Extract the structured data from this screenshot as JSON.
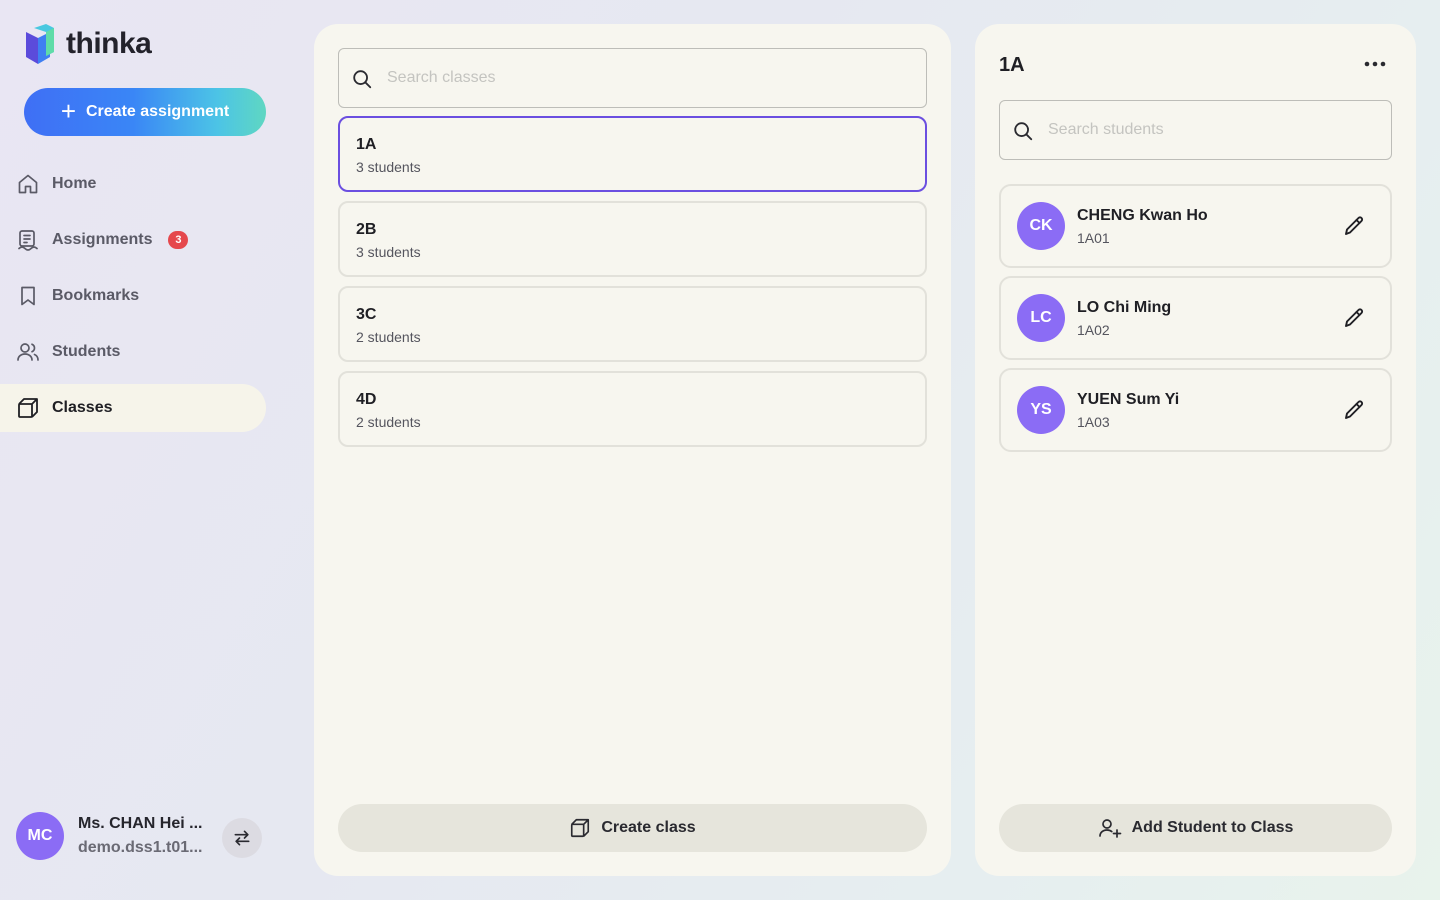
{
  "brand": {
    "name": "thinka"
  },
  "sidebar": {
    "create_label": "Create assignment",
    "items": [
      {
        "label": "Home",
        "icon": "home-icon"
      },
      {
        "label": "Assignments",
        "icon": "assignments-icon",
        "badge": "3"
      },
      {
        "label": "Bookmarks",
        "icon": "bookmark-icon"
      },
      {
        "label": "Students",
        "icon": "users-icon"
      },
      {
        "label": "Classes",
        "icon": "cube-icon",
        "active": true
      }
    ],
    "user": {
      "initials": "MC",
      "name": "Ms. CHAN Hei ...",
      "email": "demo.dss1.t01..."
    }
  },
  "classes": {
    "search_placeholder": "Search classes",
    "items": [
      {
        "name": "1A",
        "count": "3 students",
        "selected": true
      },
      {
        "name": "2B",
        "count": "3 students"
      },
      {
        "name": "3C",
        "count": "2 students"
      },
      {
        "name": "4D",
        "count": "2 students"
      }
    ],
    "create_label": "Create class"
  },
  "detail": {
    "title": "1A",
    "search_placeholder": "Search students",
    "students": [
      {
        "initials": "CK",
        "name": "CHENG Kwan Ho",
        "id": "1A01"
      },
      {
        "initials": "LC",
        "name": "LO Chi Ming",
        "id": "1A02"
      },
      {
        "initials": "YS",
        "name": "YUEN Sum Yi",
        "id": "1A03"
      }
    ],
    "add_label": "Add Student to Class"
  },
  "colors": {
    "accent": "#6b4fe0",
    "avatar": "#8b6cf5",
    "badge": "#e5484d",
    "panel": "#f7f6ef"
  }
}
